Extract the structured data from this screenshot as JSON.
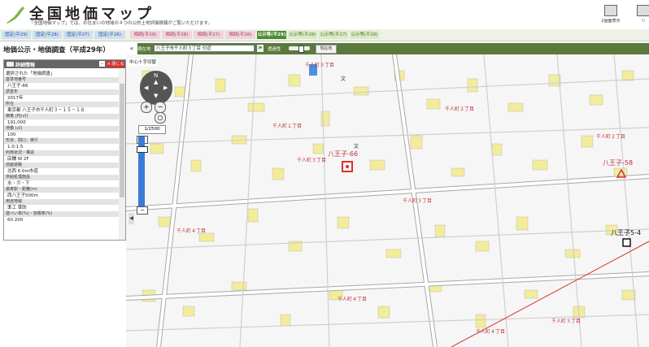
{
  "header": {
    "title": "全国地価マップ",
    "subtitle": "「全国地価マップ」では、お住まいの地域の４つの公的土地評価情報がご覧いただけます。",
    "buttons": [
      {
        "label": "2画面表示",
        "icon": "dual-screen-icon"
      },
      {
        "label": "リ",
        "icon": "reload-icon"
      }
    ]
  },
  "tabs": [
    {
      "label": "固定(平29)",
      "style": "blue"
    },
    {
      "label": "固定(平28)",
      "style": "blue"
    },
    {
      "label": "固定(平27)",
      "style": "blue"
    },
    {
      "label": "固定(平26)",
      "style": "blue"
    },
    {
      "label": "相続(平29)",
      "style": "pink"
    },
    {
      "label": "相続(平28)",
      "style": "pink"
    },
    {
      "label": "相続(平27)",
      "style": "pink"
    },
    {
      "label": "相続(平26)",
      "style": "pink"
    },
    {
      "label": "公示等(平29)",
      "style": "active"
    },
    {
      "label": "公示等(平28)",
      "style": "green"
    },
    {
      "label": "公示等(平27)",
      "style": "green"
    },
    {
      "label": "公示等(平26)",
      "style": "green"
    }
  ],
  "panel": {
    "title": "地価公示・地価調査（平成29年）",
    "collapse": "«",
    "box_title": "詳細情報",
    "minimize": "–",
    "close_label": "× 閉じる",
    "intro": "選択された「地価調査」",
    "fields": [
      {
        "label": "基準地番号",
        "value": "八王子-66"
      },
      {
        "label": "調査年",
        "value": "2017年"
      },
      {
        "label": "所在",
        "value": "東京都 八王子市千人町３－１５－１８"
      },
      {
        "label": "価格 (円/㎡)",
        "value": "191,000"
      },
      {
        "label": "地積 (㎡)",
        "value": "100"
      },
      {
        "label": "形状、間口：奥行",
        "value": "1.0:1.5"
      },
      {
        "label": "利用状況・構造",
        "value": "店舗 W 2F"
      },
      {
        "label": "前面道路",
        "value": "北西 6.0m市道"
      },
      {
        "label": "供給処理施設",
        "value": "水・ガ・下"
      },
      {
        "label": "最寄駅・距離(m)",
        "value": "西八王子500m"
      },
      {
        "label": "用途地域",
        "value": "準工 準防"
      },
      {
        "label": "建ぺい率(%)・容積率(%)",
        "value": "60 200"
      }
    ]
  },
  "toolbar": {
    "location_label": "現在地",
    "address": "八王子市千人町３丁目 付近",
    "go": "≫",
    "opacity_label": "透過性",
    "opacity_value": 0.5,
    "search_button": "現在地"
  },
  "map": {
    "layer_label": "中心十字切替",
    "scale": "1/2500",
    "nav": {
      "north": "N"
    },
    "markers": [
      {
        "label": "八王子-66",
        "kind": "selected"
      },
      {
        "label": "八王子-58",
        "kind": "triangle"
      },
      {
        "label": "八王子5-4",
        "kind": "square"
      }
    ],
    "street_labels": [
      "千人町３丁目",
      "千人町２丁目",
      "千人町１丁目",
      "千人町３丁目",
      "千人町２丁目",
      "千人町４丁目",
      "千人町４丁目",
      "千人町４丁目",
      "千人町３丁目",
      "千人町３丁目"
    ],
    "text_labels": [
      "文",
      "文"
    ]
  },
  "colors": {
    "accent": "#4c8a2e",
    "toolbar": "#5a7a3c",
    "marker": "#d9322b",
    "building": "#f3ec9b"
  }
}
